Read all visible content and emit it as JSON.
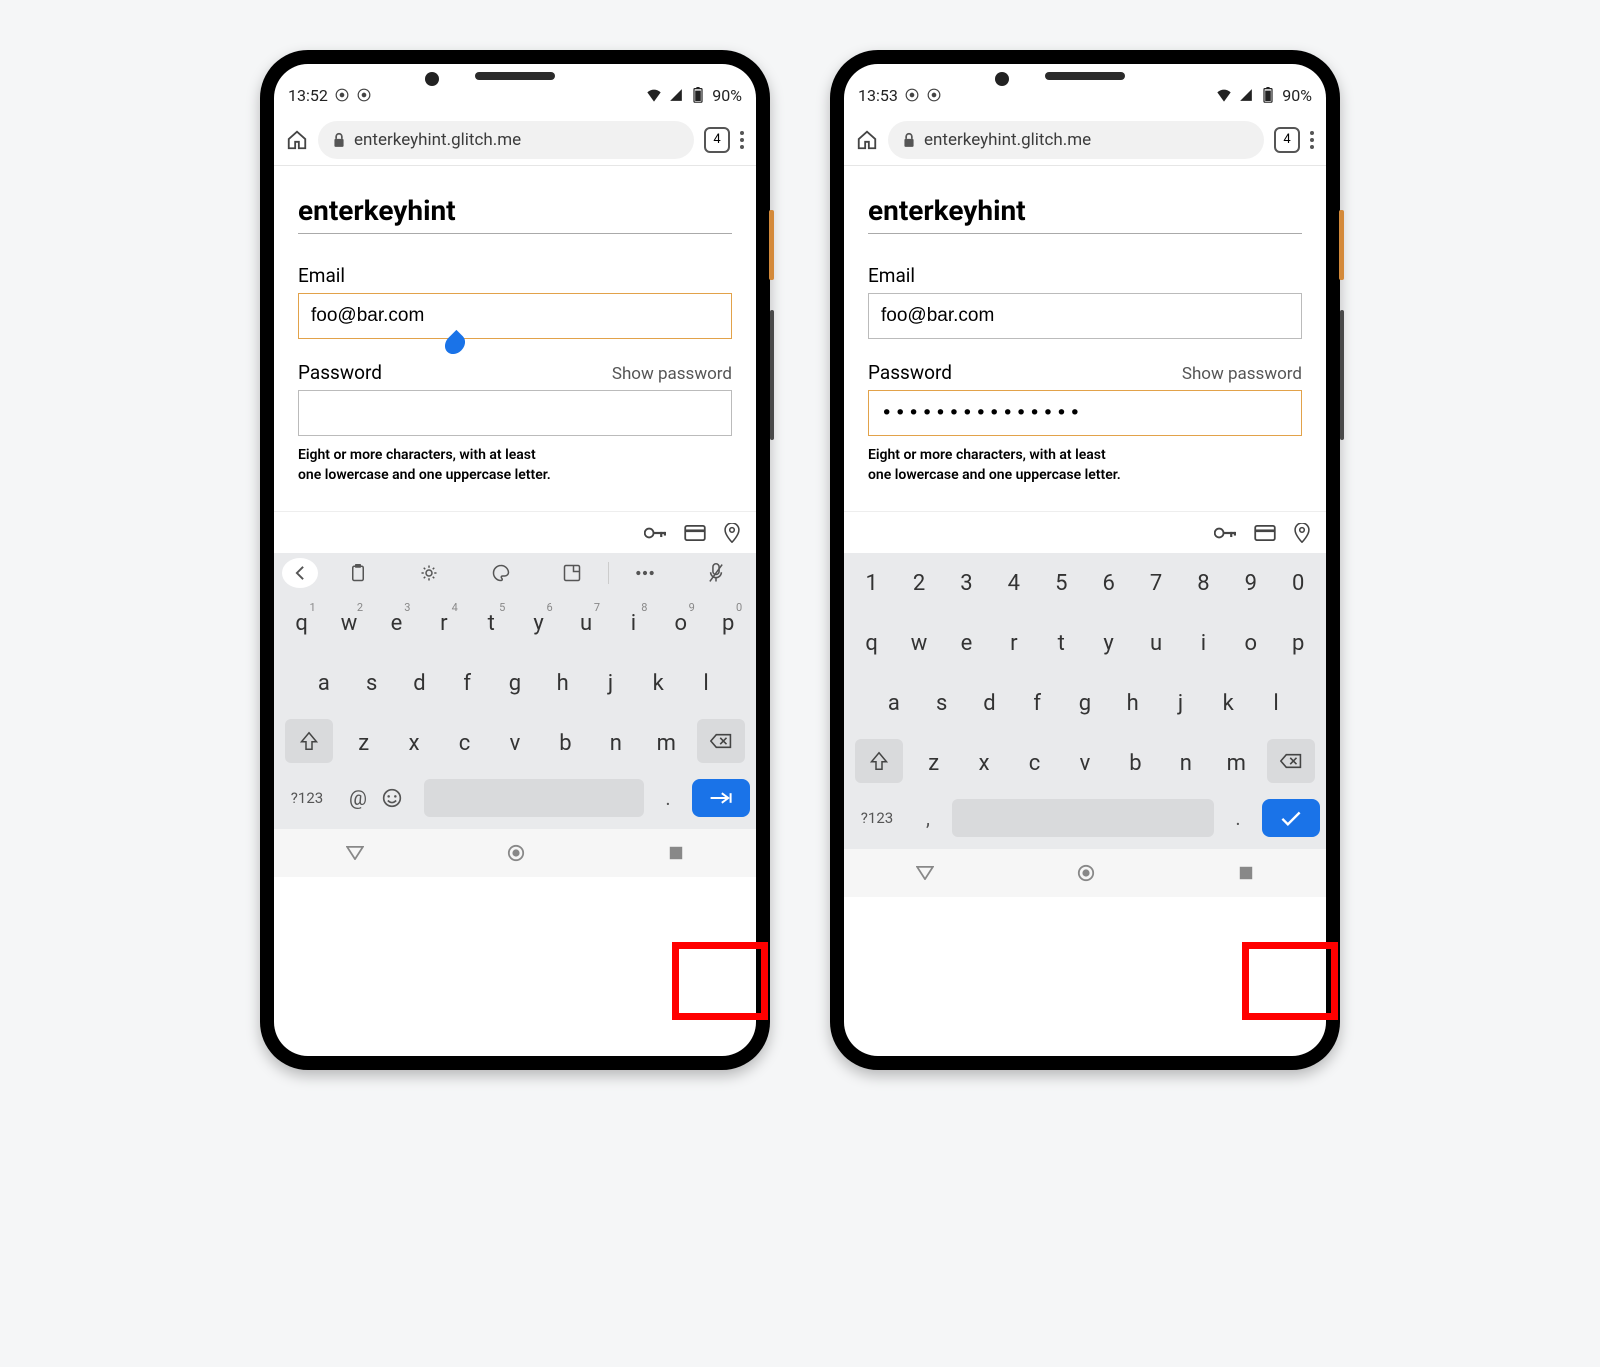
{
  "phones": [
    {
      "status": {
        "time": "13:52",
        "battery": "90%"
      },
      "url": "enterkeyhint.glitch.me",
      "tab_count": "4",
      "page_title": "enterkeyhint",
      "email_label": "Email",
      "email_value": "foo@bar.com",
      "email_focused": true,
      "password_label": "Password",
      "show_password": "Show password",
      "password_value": "",
      "password_focused": false,
      "hint_line1": "Eight or more characters, with at least",
      "hint_line2": "one lowercase and one uppercase letter.",
      "keyboard": {
        "variant": "email",
        "suggest_bar": "icons",
        "row1": [
          {
            "k": "q",
            "s": "1"
          },
          {
            "k": "w",
            "s": "2"
          },
          {
            "k": "e",
            "s": "3"
          },
          {
            "k": "r",
            "s": "4"
          },
          {
            "k": "t",
            "s": "5"
          },
          {
            "k": "y",
            "s": "6"
          },
          {
            "k": "u",
            "s": "7"
          },
          {
            "k": "i",
            "s": "8"
          },
          {
            "k": "o",
            "s": "9"
          },
          {
            "k": "p",
            "s": "0"
          }
        ],
        "row2": [
          "a",
          "s",
          "d",
          "f",
          "g",
          "h",
          "j",
          "k",
          "l"
        ],
        "row3": [
          "z",
          "x",
          "c",
          "v",
          "b",
          "n",
          "m"
        ],
        "sym_label": "?123",
        "left_extra": "@",
        "emoji": true,
        "dot": ".",
        "enter_icon": "next"
      }
    },
    {
      "status": {
        "time": "13:53",
        "battery": "90%"
      },
      "url": "enterkeyhint.glitch.me",
      "tab_count": "4",
      "page_title": "enterkeyhint",
      "email_label": "Email",
      "email_value": "foo@bar.com",
      "email_focused": false,
      "password_label": "Password",
      "show_password": "Show password",
      "password_value": "•••••••••••••••",
      "password_focused": true,
      "hint_line1": "Eight or more characters, with at least",
      "hint_line2": "one lowercase and one uppercase letter.",
      "keyboard": {
        "variant": "password",
        "suggest_bar": "numbers",
        "num_row": [
          "1",
          "2",
          "3",
          "4",
          "5",
          "6",
          "7",
          "8",
          "9",
          "0"
        ],
        "row1": [
          {
            "k": "q"
          },
          {
            "k": "w"
          },
          {
            "k": "e"
          },
          {
            "k": "r"
          },
          {
            "k": "t"
          },
          {
            "k": "y"
          },
          {
            "k": "u"
          },
          {
            "k": "i"
          },
          {
            "k": "o"
          },
          {
            "k": "p"
          }
        ],
        "row2": [
          "a",
          "s",
          "d",
          "f",
          "g",
          "h",
          "j",
          "k",
          "l"
        ],
        "row3": [
          "z",
          "x",
          "c",
          "v",
          "b",
          "n",
          "m"
        ],
        "sym_label": "?123",
        "left_extra": ",",
        "emoji": false,
        "dot": ".",
        "enter_icon": "done"
      }
    }
  ]
}
